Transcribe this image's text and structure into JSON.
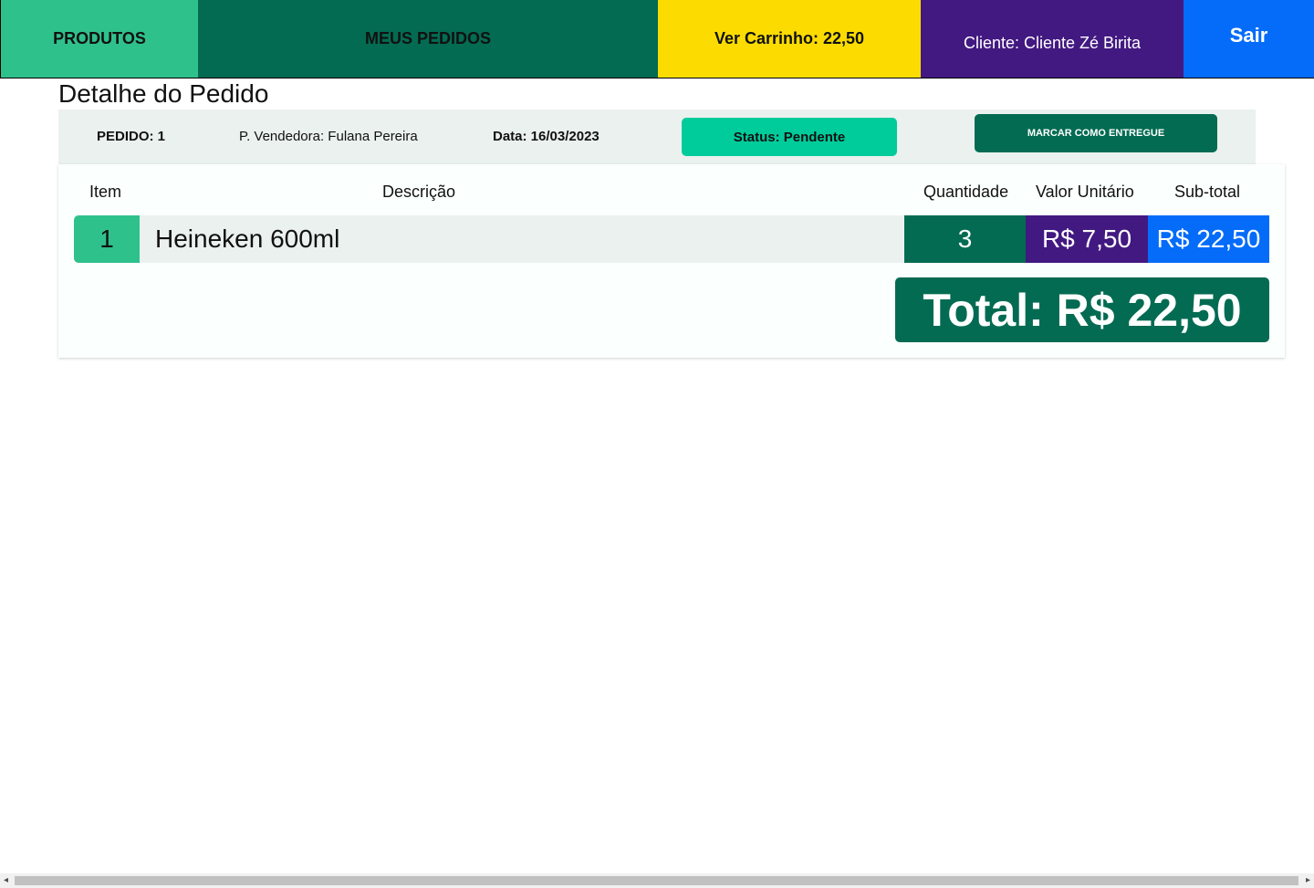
{
  "navbar": {
    "produtos": "PRODUTOS",
    "meus_pedidos": "MEUS PEDIDOS",
    "carrinho": "Ver Carrinho: 22,50",
    "cliente": "Cliente: Cliente Zé Birita",
    "sair": "Sair"
  },
  "page": {
    "title": "Detalhe do Pedido"
  },
  "order_info": {
    "pedido": "PEDIDO: 1",
    "vendedora": "P. Vendedora: Fulana Pereira",
    "data": "Data: 16/03/2023",
    "status": "Status: Pendente",
    "mark_delivered": "MARCAR COMO ENTREGUE"
  },
  "table": {
    "headers": {
      "item": "Item",
      "descricao": "Descrição",
      "quantidade": "Quantidade",
      "valor_unitario": "Valor Unitário",
      "subtotal": "Sub-total"
    },
    "rows": [
      {
        "item": "1",
        "descricao": "Heineken 600ml",
        "quantidade": "3",
        "valor_unitario": "R$ 7,50",
        "subtotal": "R$ 22,50"
      }
    ]
  },
  "total": "Total: R$ 22,50",
  "colors": {
    "green_light": "#2fc18c",
    "green_dark": "#036b52",
    "yellow": "#fcdc00",
    "purple": "#421981",
    "blue": "#056cf9",
    "status_green": "#00cc9b"
  }
}
